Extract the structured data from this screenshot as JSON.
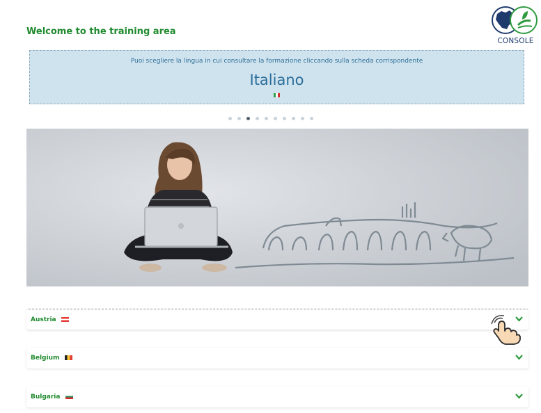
{
  "header": {
    "title": "Welcome to the training area"
  },
  "logo": {
    "text": "CONSOLE",
    "icon": "eu-leaf-logo"
  },
  "language_selector": {
    "hint": "Puoi scegliere la lingua in cui consultare la formazione cliccando sulla scheda corrispondente",
    "language": "Italiano",
    "flag": "italy-flag",
    "slides_total": 10,
    "active_slide": 3
  },
  "hero": {
    "description_icon": "woman-laptop-farm-illustration"
  },
  "countries": [
    {
      "label": "Austria",
      "flag": "austria-flag"
    },
    {
      "label": "Belgium",
      "flag": "belgium-flag"
    },
    {
      "label": "Bulgaria",
      "flag": "bulgaria-flag"
    }
  ],
  "colors": {
    "brand_green": "#1f8a2e",
    "lang_box_bg": "#cfe3ef",
    "lang_text": "#2c6e99",
    "chevron_green": "#2e9a3f"
  }
}
